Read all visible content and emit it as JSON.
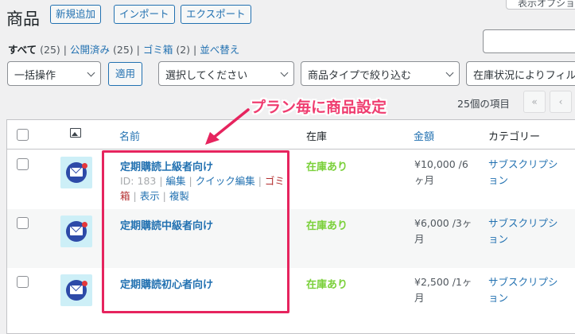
{
  "header": {
    "title": "商品",
    "buttons": [
      "新規追加",
      "インポート",
      "エクスポート"
    ],
    "screen_options": "表示オプション"
  },
  "filters_links": {
    "all": "すべて",
    "all_count": "(25)",
    "published": "公開済み",
    "published_count": "(25)",
    "trash": "ゴミ箱",
    "trash_count": "(2)",
    "sort": "並べ替え",
    "sep": "|"
  },
  "toolbar": {
    "bulk_action": "一括操作",
    "apply": "適用",
    "category_select": "選択してください",
    "type_filter": "商品タイプで絞り込む",
    "stock_filter": "在庫状況によりフィルター",
    "items_count": "25個の項目",
    "first_page": "«",
    "prev_page": "‹"
  },
  "table": {
    "columns": {
      "name": "名前",
      "stock": "在庫",
      "price": "金額",
      "category": "カテゴリー"
    },
    "rows": [
      {
        "name": "定期購読上級者向け",
        "id_text": "ID: 183 |",
        "edit": "編集",
        "quick_edit": "クイック編集",
        "trash_1": "ゴミ",
        "trash_2": "箱",
        "view": "表示",
        "duplicate": "複製",
        "stock": "在庫あり",
        "price_1": "¥10,000 /6",
        "price_2": "ヶ月",
        "cat_1": "サブスクリプシ",
        "cat_2": "ョン"
      },
      {
        "name": "定期購読中級者向け",
        "stock": "在庫あり",
        "price_1": "¥6,000 /3ヶ",
        "price_2": "月",
        "cat_1": "サブスクリプシ",
        "cat_2": "ョン"
      },
      {
        "name": "定期購読初心者向け",
        "stock": "在庫あり",
        "price_1": "¥2,500 /1ヶ",
        "price_2": "月",
        "cat_1": "サブスクリプシ",
        "cat_2": "ョン"
      }
    ]
  },
  "annotation": {
    "callout": "プラン毎に商品設定",
    "color": "#e6245e"
  },
  "colors": {
    "link": "#2271b1",
    "in_stock": "#7ad03a",
    "trash": "#b32d2e"
  }
}
